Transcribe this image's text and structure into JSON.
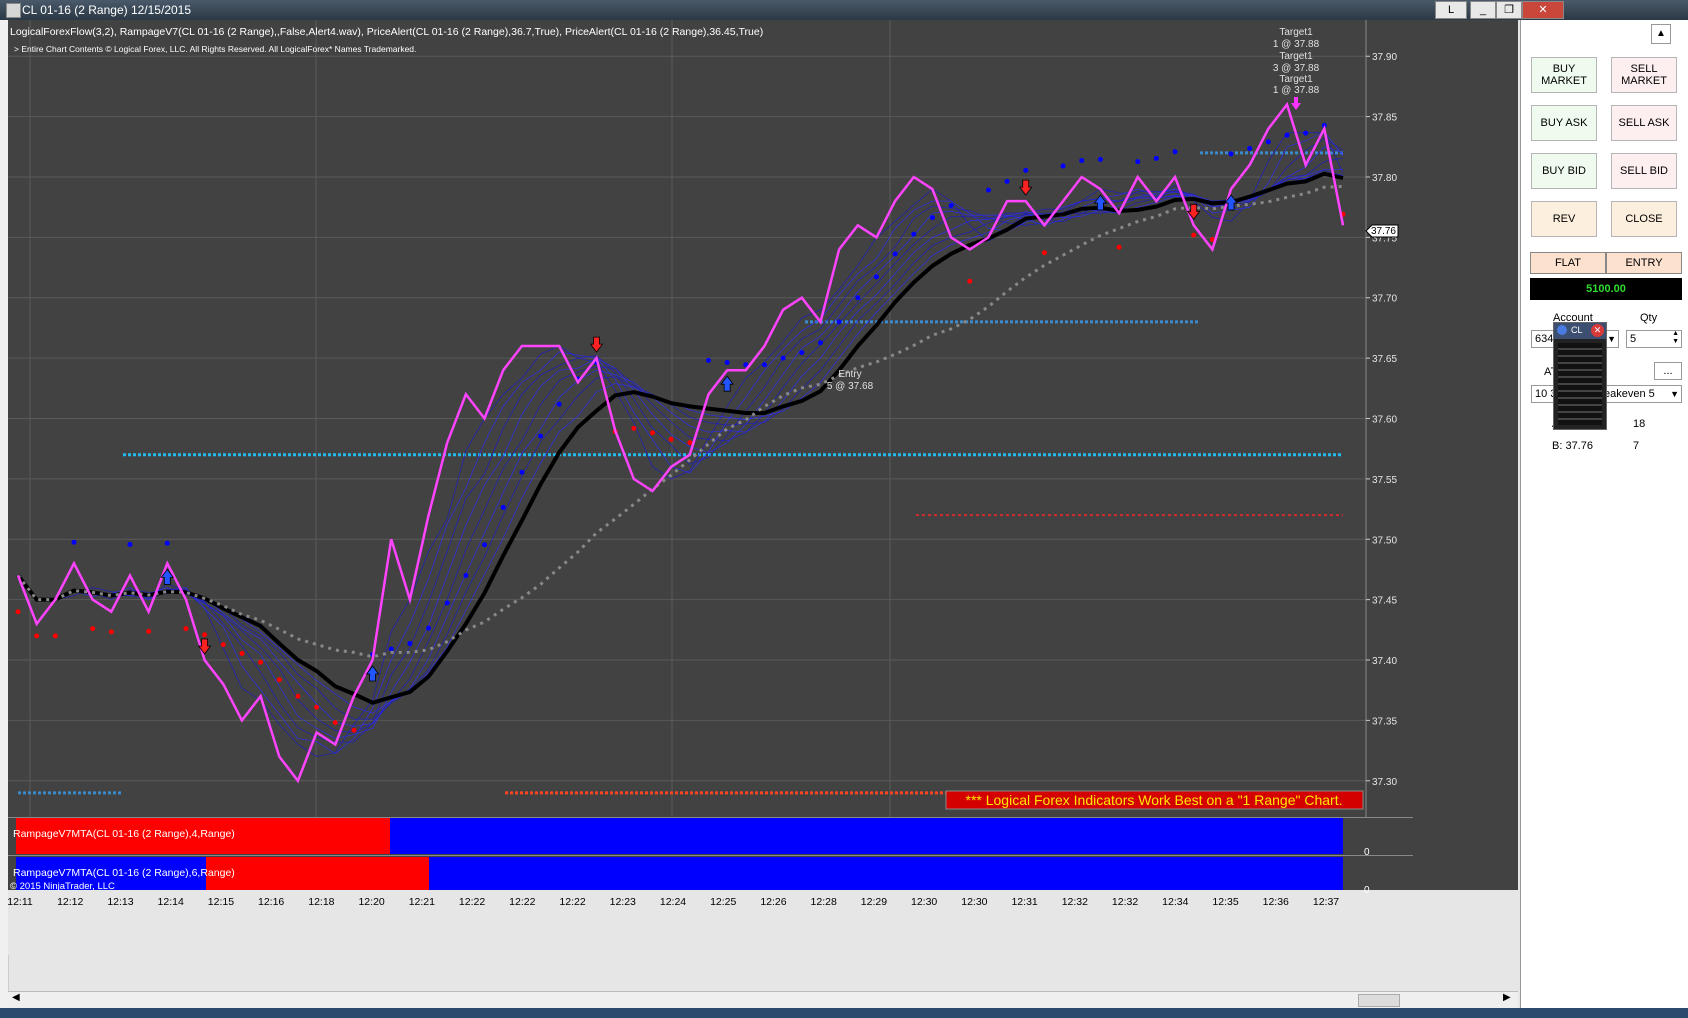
{
  "window": {
    "title": "CL 01-16 (2 Range)  12/15/2015",
    "top_right_tab": "L"
  },
  "chart": {
    "indicator_header": "LogicalForexFlow(3,2), RampageV7(CL 01-16 (2 Range),,False,Alert4.wav), PriceAlert(CL 01-16 (2 Range),36.7,True), PriceAlert(CL 01-16 (2 Range),36.45,True)",
    "copyright_notice": "> Entire Chart Contents © Logical Forex, LLC. All Rights Reserved. All LogicalForex* Names Trademarked.",
    "targets": [
      "Target1",
      "1 @ 37.88",
      "Target1",
      "3 @ 37.88",
      "Target1",
      "1 @ 37.88"
    ],
    "entry_label": "Entry",
    "entry_detail": "5 @ 37.68",
    "current_price": "37.76",
    "banner": "*** Logical Forex Indicators Work Best on a \"1 Range\" Chart.",
    "subpanel1_label": "RampageV7MTA(CL 01-16 (2 Range),4,Range)",
    "subpanel2_label": "RampageV7MTA(CL 01-16 (2 Range),6,Range)",
    "subpanel_zero": "0",
    "ninja_copyright": "© 2015 NinjaTrader, LLC",
    "colors": {
      "background": "#424242",
      "price_line": "#ff44ff",
      "sma_black": "#000000",
      "dots_blue": "#0000ff",
      "dots_red": "#ff0000",
      "cyan_level": "#22bbee",
      "bull_panel": "#0000ff",
      "bear_panel": "#ff0000"
    }
  },
  "chart_data": {
    "type": "line",
    "ylim": [
      37.27,
      37.93
    ],
    "y_ticks": [
      "37.90",
      "37.85",
      "37.80",
      "37.75",
      "37.70",
      "37.65",
      "37.60",
      "37.55",
      "37.50",
      "37.45",
      "37.40",
      "37.35",
      "37.30"
    ],
    "x_ticks": [
      "12:11",
      "12:12",
      "12:13",
      "12:14",
      "12:15",
      "12:16",
      "12:18",
      "12:20",
      "12:21",
      "12:22",
      "12:22",
      "12:22",
      "12:23",
      "12:24",
      "12:25",
      "12:26",
      "12:28",
      "12:29",
      "12:30",
      "12:30",
      "12:31",
      "12:32",
      "12:32",
      "12:34",
      "12:35",
      "12:36",
      "12:37"
    ],
    "series": [
      {
        "values": [
          37.47,
          37.43,
          37.45,
          37.48,
          37.45,
          37.44,
          37.47,
          37.44,
          37.48,
          37.45,
          37.4,
          37.38,
          37.35,
          37.37,
          37.32,
          37.3,
          37.34,
          37.33,
          37.37,
          37.4,
          37.5,
          37.45,
          37.52,
          37.58,
          37.62,
          37.6,
          37.64,
          37.66,
          37.66,
          37.66,
          37.63,
          37.65,
          37.59,
          37.55,
          37.54,
          37.56,
          37.57,
          37.62,
          37.64,
          37.64,
          37.66,
          37.69,
          37.7,
          37.68,
          37.74,
          37.76,
          37.75,
          37.78,
          37.8,
          37.79,
          37.75,
          37.74,
          37.75,
          37.78,
          37.78,
          37.76,
          37.78,
          37.8,
          37.79,
          37.77,
          37.8,
          37.78,
          37.8,
          37.76,
          37.74,
          37.79,
          37.81,
          37.84,
          37.86,
          37.81,
          37.84,
          37.76
        ]
      }
    ]
  },
  "panel": {
    "buy_market": "BUY MARKET",
    "sell_market": "SELL MARKET",
    "buy_ask": "BUY ASK",
    "sell_ask": "SELL ASK",
    "buy_bid": "BUY BID",
    "sell_bid": "SELL BID",
    "rev": "REV",
    "close": "CLOSE",
    "flat": "FLAT",
    "entry": "ENTRY",
    "pnl": "5100.00",
    "account_label": "Account",
    "qty_label": "Qty",
    "account_value": "634",
    "qty_value": "5",
    "atm_label": "AT",
    "atm_suffix": "y",
    "atm_value": "10 3",
    "strategy_value": "eakeven 5",
    "more_btn": "...",
    "row1_left": "A",
    "row1_right": "18",
    "row2_left": "B: 37.76",
    "row2_right": "7",
    "popup_title": "CL"
  }
}
